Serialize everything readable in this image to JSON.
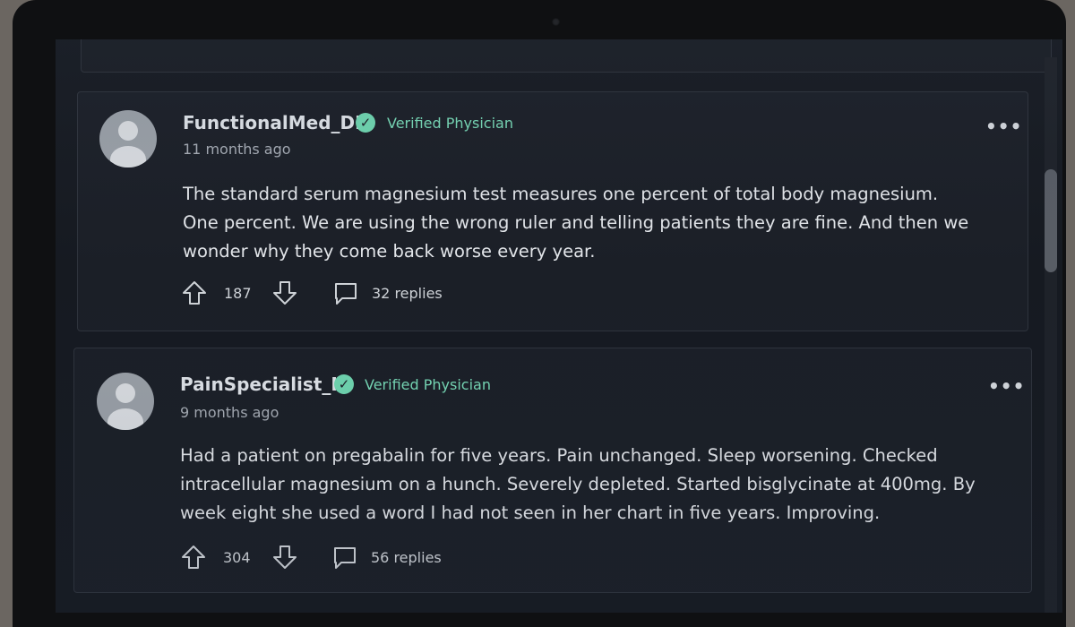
{
  "posts": [
    {
      "author": "FunctionalMed_DR",
      "badge_label": "Verified Physician",
      "timestamp": "11 months ago",
      "text": "The standard serum magnesium test measures one percent of total body magnesium. One percent. We are using the wrong ruler and telling patients they are fine. And then we wonder why they come back worse every year.",
      "upvotes": "187",
      "replies": "32 replies"
    },
    {
      "author": "PainSpecialist_K",
      "badge_label": "Verified Physician",
      "timestamp": "9 months ago",
      "text": "Had a patient on pregabalin for five years. Pain unchanged. Sleep worsening. Checked intracellular magnesium on a hunch. Severely depleted. Started bisglycinate at 400mg. By week eight she used a word I had not seen in her chart in five years. Improving.",
      "upvotes": "304",
      "replies": "56 replies"
    }
  ],
  "icons": {
    "verified": "check-circle-icon",
    "more": "more-options-icon",
    "upvote": "arrow-up-icon",
    "downvote": "arrow-down-icon",
    "reply": "comment-bubble-icon"
  },
  "colors": {
    "verified_accent": "#77d9b6",
    "background": "#161a21",
    "card": "#1b1f27"
  }
}
